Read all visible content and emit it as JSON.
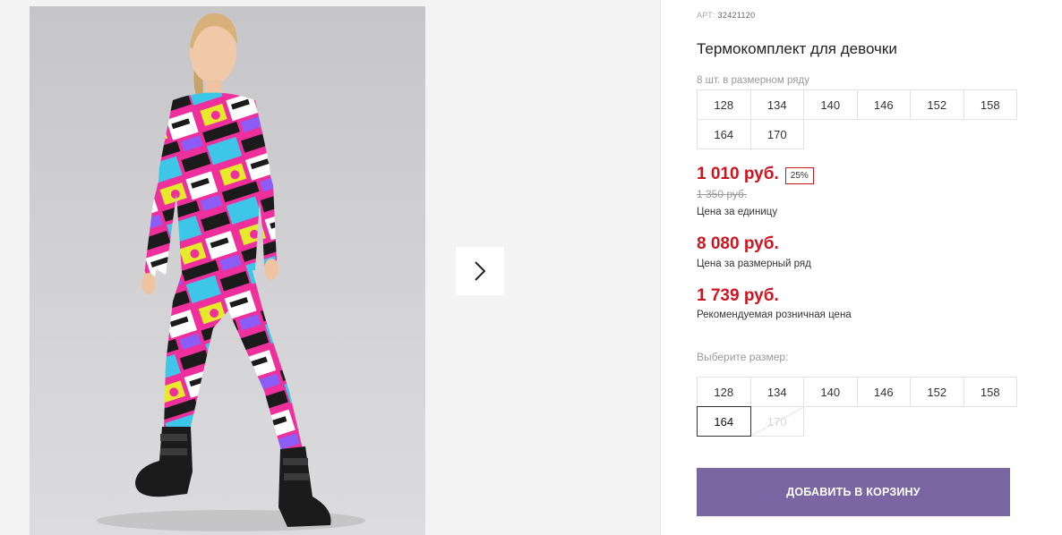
{
  "product": {
    "article_label": "АРТ:",
    "article_value": "32421120",
    "title": "Термокомплект для девочки",
    "pack_note": "8 шт. в размерном ряду",
    "pack_sizes": [
      "128",
      "134",
      "140",
      "146",
      "152",
      "158",
      "164",
      "170"
    ],
    "price": "1 010 руб.",
    "discount_badge": "25%",
    "old_price": "1 350 руб.",
    "unit_price_caption": "Цена за единицу",
    "pack_price": "8 080 руб.",
    "pack_price_caption": "Цена за размерный ряд",
    "retail_price": "1 739 руб.",
    "retail_price_caption": "Рекомендуемая розничная цена"
  },
  "size_picker": {
    "label": "Выберите размер:",
    "sizes": [
      "128",
      "134",
      "140",
      "146",
      "152",
      "158",
      "164",
      "170"
    ],
    "selected": "164",
    "unavailable": [
      "170"
    ]
  },
  "cart_button": {
    "label": "ДОБАВИТЬ В КОРЗИНУ"
  },
  "gallery": {
    "next_icon": "chevron-right-icon"
  },
  "colors": {
    "accent": "#7a66a3",
    "price_red": "#d0141f",
    "outfit_pink": "#ee2f9c",
    "outfit_cyan": "#3ec6e8",
    "outfit_yellow": "#e7ea2b",
    "outfit_black": "#1b1b1b"
  }
}
